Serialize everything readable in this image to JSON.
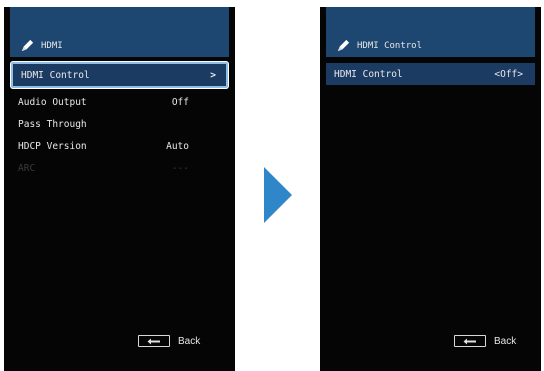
{
  "left": {
    "header_title": "HDMI",
    "menu": [
      {
        "label": "HDMI Control",
        "value": ">",
        "selected": true
      },
      {
        "label": "Audio Output",
        "value": "Off"
      },
      {
        "label": "Pass Through",
        "value": ""
      },
      {
        "label": "HDCP Version",
        "value": "Auto"
      },
      {
        "label": "ARC",
        "value": "---",
        "disabled": true
      }
    ],
    "back_label": "Back"
  },
  "right": {
    "header_title": "HDMI Control",
    "item_label": "HDMI Control",
    "item_value": "<Off>",
    "back_label": "Back"
  },
  "colors": {
    "header_bg": "#1d4770",
    "selection_bg": "#1c3b63",
    "selection_border": "#8fbde6",
    "arrow": "#2f86c8",
    "screen_bg": "#050505"
  },
  "icons": {
    "header": "pen-icon",
    "back_key": "return-key-icon",
    "transition": "right-arrow-icon"
  }
}
